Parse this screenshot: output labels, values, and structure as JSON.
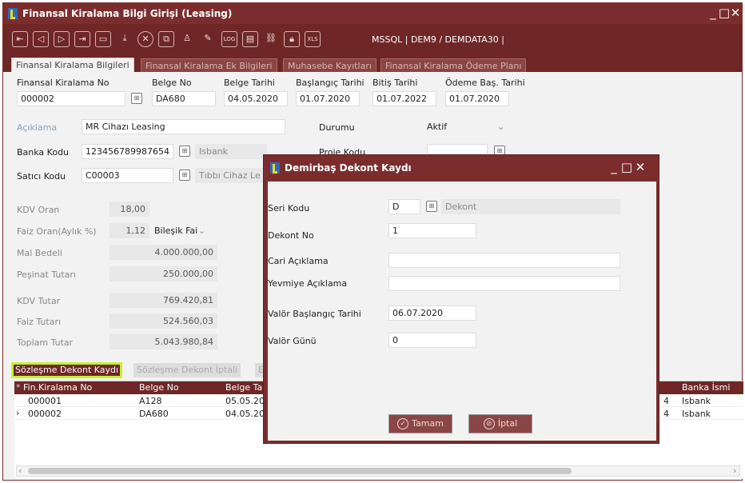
{
  "window": {
    "title": "Finansal Kiralama Bilgi Girişi (Leasing)"
  },
  "toolbar": {
    "connection": "MSSQL | DEM9 / DEMDATA30 |"
  },
  "tabs": [
    "Finansal Kiralama Bilgileri",
    "Finansal Kiralama Ek Bilgileri",
    "Muhasebe Kayıtları",
    "Finansal Kiralama Ödeme Planı"
  ],
  "header_fields": {
    "no_label": "Finansal Kiralama No",
    "no_value": "000002",
    "belge_no_label": "Belge No",
    "belge_no_value": "DA680",
    "belge_tarihi_label": "Belge Tarihi",
    "belge_tarihi_value": "04.05.2020",
    "baslangic_label": "Başlangıç Tarihi",
    "baslangic_value": "01.07.2020",
    "bitis_label": "Bitiş Tarihi",
    "bitis_value": "01.07.2022",
    "odeme_label": "Ödeme Baş. Tarihi",
    "odeme_value": "01.07.2020"
  },
  "form": {
    "aciklama_label": "Açıklama",
    "aciklama_value": "MR Cihazı Leasing",
    "durumu_label": "Durumu",
    "durumu_value": "Aktif",
    "banka_label": "Banka Kodu",
    "banka_value": "123456789987654",
    "banka_name": "Isbank",
    "proje_label": "Proje Kodu",
    "satici_label": "Satıcı Kodu",
    "satici_value": "C00003",
    "satici_name": "Tıbbı Cihaz Le"
  },
  "amounts": {
    "kdv_oran_label": "KDV Oran",
    "kdv_oran_value": "18,00",
    "faiz_label": "Faiz Oran(Aylık %)",
    "faiz_value": "1,12",
    "faiz_type": "Bileşik Faiz",
    "mal_label": "Mal Bedeli",
    "mal_value": "4.000.000,00",
    "pesinat_label": "Peşinat Tutarı",
    "pesinat_value": "250.000,00",
    "kdv_tutar_label": "KDV Tutar",
    "kdv_tutar_value": "769.420,81",
    "faiz_tutar_label": "Faiz Tutarı",
    "faiz_tutar_value": "524.560,03",
    "toplam_label": "Toplam Tutar",
    "toplam_value": "5.043.980,84"
  },
  "bottom_tabs": {
    "active": "Sözleşme Dekont Kaydı",
    "inactive": "Sözleşme Dekont İptali",
    "third": "E"
  },
  "grid": {
    "headers": {
      "no": "Fin.Kiralama No",
      "belge": "Belge No",
      "tarih": "Belge Ta",
      "banka": "Banka İsmi"
    },
    "rows": [
      {
        "no": "000001",
        "belge": "A128",
        "tarih": "05.05.20",
        "tail": "4",
        "banka": "Isbank"
      },
      {
        "no": "000002",
        "belge": "DA680",
        "tarih": "04.05.20",
        "tail": "4",
        "banka": "Isbank"
      }
    ]
  },
  "dialog": {
    "title": "Demirbaş Dekont Kaydı",
    "seri_label": "Seri Kodu",
    "seri_value": "D",
    "seri_name": "Dekont",
    "dekont_no_label": "Dekont No",
    "dekont_no_value": "1",
    "cari_label": "Cari Açıklama",
    "cari_value": "",
    "yevmiye_label": "Yevmiye Açıklama",
    "yevmiye_value": "",
    "valor_bas_label": "Valör Başlangıç Tarihi",
    "valor_bas_value": "06.07.2020",
    "valor_gun_label": "Valör Günü",
    "valor_gun_value": "0",
    "ok_label": "Tamam",
    "cancel_label": "İptal"
  },
  "colors": {
    "titlebar": "#7b2d2d",
    "toolbar": "#6e2626",
    "highlight": "#c7f22e"
  }
}
